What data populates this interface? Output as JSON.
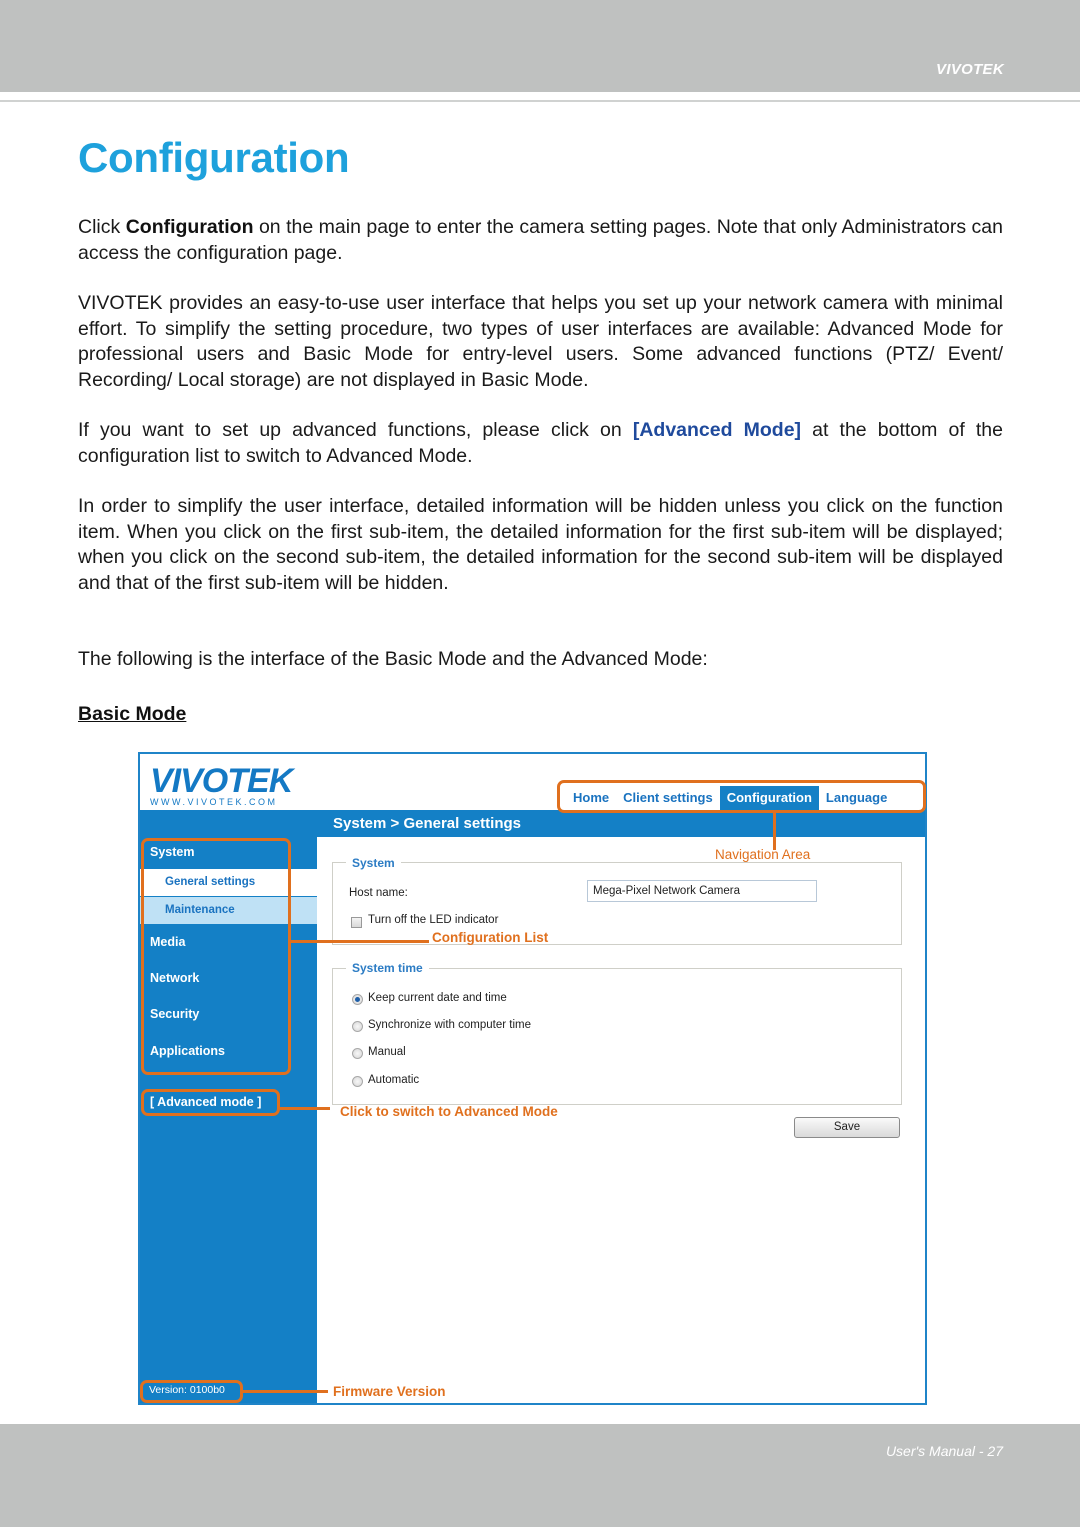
{
  "header": {
    "brand": "VIVOTEK"
  },
  "page_title": "Configuration",
  "paragraphs": {
    "p1_pre": "Click ",
    "p1_bold": "Configuration",
    "p1_post": " on the main page to enter the camera setting pages. Note that only Administrators can access the configuration page.",
    "p2": "VIVOTEK provides an easy-to-use user interface that helps you set up your network camera with minimal effort. To simplify the setting procedure, two types of user interfaces are available: Advanced Mode for professional users and Basic Mode for entry-level users. Some advanced functions (PTZ/ Event/ Recording/ Local storage) are not displayed in Basic Mode.",
    "p3_pre": "If you want to set up advanced functions, please click on ",
    "p3_link": "[Advanced Mode]",
    "p3_post": " at the bottom of the configuration list to switch to Advanced Mode.",
    "p4": "In order to simplify the user interface, detailed information will be hidden unless you click on the function item. When you click on the first sub-item, the detailed information for the first sub-item will be displayed; when you click on the second sub-item, the detailed information for the second sub-item will be displayed and that of the first sub-item will be hidden.",
    "p5": "The following is the interface of the Basic Mode and the Advanced Mode:"
  },
  "subheading": "Basic Mode",
  "screenshot": {
    "logo_word": "VIVOTEK",
    "logo_url": "WWW.VIVOTEK.COM",
    "breadcrumb": "System  > General settings",
    "top_nav": [
      {
        "label": "Home",
        "active": false
      },
      {
        "label": "Client settings",
        "active": false
      },
      {
        "label": "Configuration",
        "active": true
      },
      {
        "label": "Language",
        "active": false
      }
    ],
    "sidebar": {
      "system": "System",
      "sub_general": "General settings",
      "sub_maintenance": "Maintenance",
      "media": "Media",
      "network": "Network",
      "security": "Security",
      "applications": "Applications",
      "advanced_mode": "[ Advanced mode ]",
      "version": "Version: 0100b0"
    },
    "system_section": {
      "legend": "System",
      "host_label": "Host name:",
      "host_value": "Mega-Pixel Network Camera",
      "led_label": "Turn off the LED indicator",
      "led_checked": false
    },
    "time_section": {
      "legend": "System time",
      "options": [
        {
          "label": "Keep current date and time",
          "selected": true
        },
        {
          "label": "Synchronize with computer time",
          "selected": false
        },
        {
          "label": "Manual",
          "selected": false
        },
        {
          "label": "Automatic",
          "selected": false
        }
      ]
    },
    "save_label": "Save",
    "annotations": {
      "navigation_area": "Navigation Area",
      "configuration_list": "Configuration List",
      "advanced_switch": "Click to switch to Advanced Mode",
      "firmware_version": "Firmware Version"
    },
    "annotation_color": "#e0701e",
    "accent_color": "#1480c6"
  },
  "footer": {
    "page_label": "User's Manual - 27"
  }
}
